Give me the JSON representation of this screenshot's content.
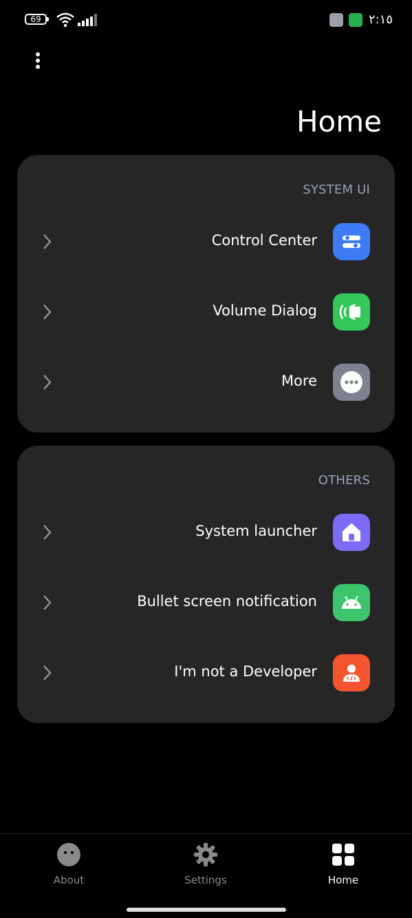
{
  "status_bar": {
    "battery_level": "69",
    "time": "٢:١٥"
  },
  "page": {
    "title": "Home"
  },
  "sections": [
    {
      "header": "SYSTEM UI",
      "items": [
        {
          "label": "Control Center",
          "icon": "toggles-icon",
          "color": "#3d7cf5"
        },
        {
          "label": "Volume Dialog",
          "icon": "volume-icon",
          "color": "#34c759"
        },
        {
          "label": "More",
          "icon": "more-dots-icon",
          "color": "#7e8190"
        }
      ]
    },
    {
      "header": "OTHERS",
      "items": [
        {
          "label": "System launcher",
          "icon": "home-icon",
          "color": "#7b6cf6"
        },
        {
          "label": "Bullet screen notification",
          "icon": "android-icon",
          "color": "#3ec56b"
        },
        {
          "label": "I'm not a Developer",
          "icon": "developer-icon",
          "color": "#f4542e"
        }
      ]
    }
  ],
  "bottom_nav": [
    {
      "label": "About",
      "icon": "face-icon",
      "active": false
    },
    {
      "label": "Settings",
      "icon": "gear-icon",
      "active": false
    },
    {
      "label": "Home",
      "icon": "grid-icon",
      "active": true
    }
  ]
}
